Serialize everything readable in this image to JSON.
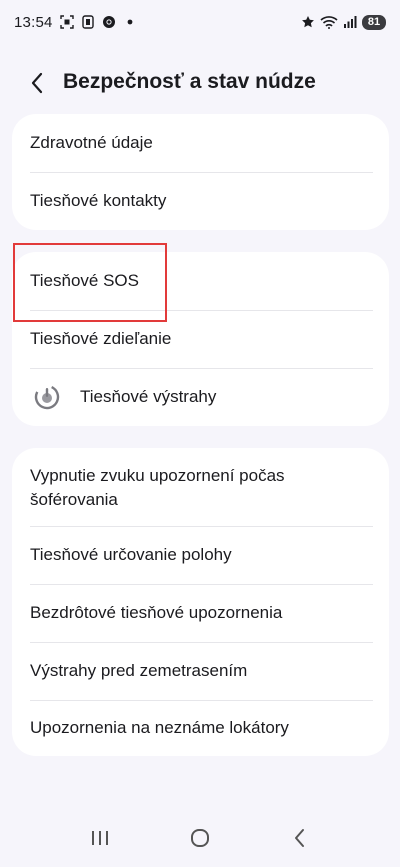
{
  "status_bar": {
    "time": "13:54",
    "battery": "81",
    "icons": [
      "screenshot-icon",
      "sim-icon",
      "chrome-icon",
      "dot-icon",
      "star-icon",
      "wifi-icon",
      "signal-icon"
    ]
  },
  "header": {
    "title": "Bezpečnosť a stav núdze"
  },
  "groups": [
    {
      "items": [
        {
          "label": "Zdravotné údaje"
        },
        {
          "label": "Tiesňové kontakty"
        }
      ]
    },
    {
      "items": [
        {
          "label": "Tiesňové SOS"
        },
        {
          "label": "Tiesňové zdieľanie"
        },
        {
          "label": "Tiesňové výstrahy"
        }
      ]
    },
    {
      "items": [
        {
          "label": "Vypnutie zvuku upozornení počas šoférovania"
        },
        {
          "label": "Tiesňové určovanie polohy"
        },
        {
          "label": "Bezdrôtové tiesňové upozornenia"
        },
        {
          "label": "Výstrahy pred zemetrasením"
        },
        {
          "label": "Upozornenia na neznáme lokátory"
        }
      ]
    }
  ],
  "colors": {
    "background": "#f6f5fb",
    "card": "#ffffff",
    "highlight": "#e23a3a"
  }
}
